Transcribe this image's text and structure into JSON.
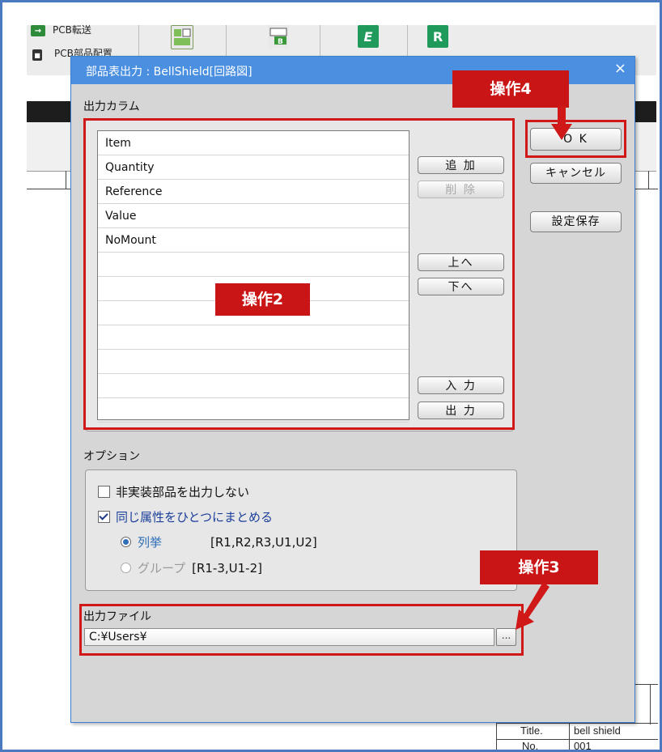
{
  "background_app": {
    "toolbar_labels": [
      "PCB転送",
      "PCB部品配置"
    ],
    "title_block": {
      "title_key": "Title.",
      "title_value": "bell shield",
      "no_key": "No.",
      "no_value": "001"
    }
  },
  "dialog": {
    "title": "部品表出力 : BellShield[回路図]",
    "close_glyph": "×",
    "output_columns_label": "出力カラム",
    "columns": [
      "Item",
      "Quantity",
      "Reference",
      "Value",
      "NoMount",
      "",
      "",
      "",
      "",
      "",
      "",
      ""
    ],
    "buttons": {
      "add": "追 加",
      "remove": "削 除",
      "up": "上へ",
      "down": "下へ",
      "import": "入 力",
      "export": "出 力",
      "ok": "O K",
      "cancel": "キャンセル",
      "save_settings": "設定保存",
      "browse": "..."
    },
    "options_label": "オプション",
    "options": {
      "no_mount": {
        "label": "非実装部品を出力しない",
        "checked": false
      },
      "merge_same": {
        "label": "同じ属性をひとつにまとめる",
        "checked": true
      },
      "radio_list": {
        "label": "列挙",
        "example": "[R1,R2,R3,U1,U2]",
        "selected": true
      },
      "radio_group": {
        "label": "グループ",
        "example": "[R1-3,U1-2]",
        "selected": false
      }
    },
    "output_file_label": "出力ファイル",
    "output_file_value": "C:¥Users¥"
  },
  "annotations": {
    "step2": "操作2",
    "step3": "操作3",
    "step4": "操作4",
    "color": "#d01818"
  }
}
